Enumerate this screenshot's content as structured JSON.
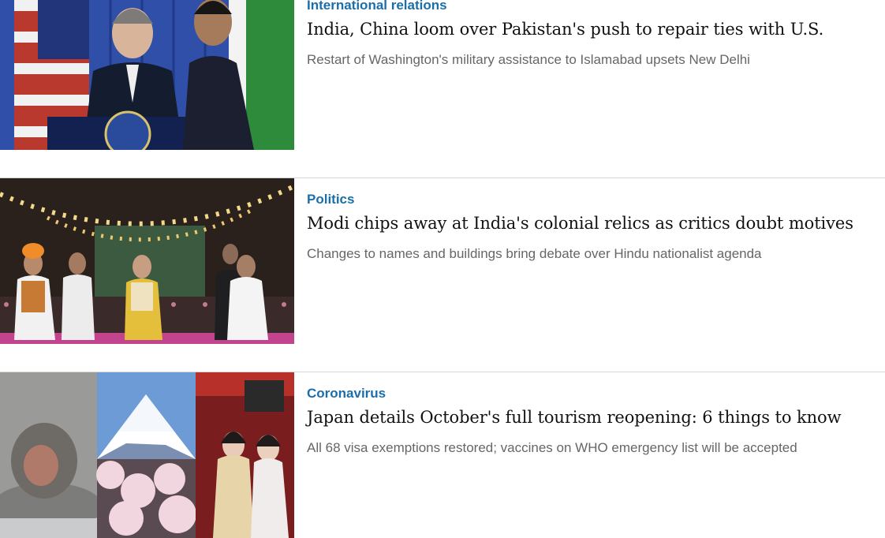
{
  "articles": [
    {
      "category": "International relations",
      "headline": "India, China loom over Pakistan's push to repair ties with U.S.",
      "dek": "Restart of Washington's military assistance to Islamabad upsets New Delhi"
    },
    {
      "category": "Politics",
      "headline": "Modi chips away at India's colonial relics as critics doubt motives",
      "dek": "Changes to names and buildings bring debate over Hindu nationalist agenda"
    },
    {
      "category": "Coronavirus",
      "headline": "Japan details October's full tourism reopening: 6 things to know",
      "dek": "All 68 visa exemptions restored; vaccines on WHO emergency list will be accepted"
    }
  ],
  "colors": {
    "category": "#1a6fab",
    "headline": "#111111",
    "dek": "#666666",
    "divider": "#d6d6d6"
  }
}
